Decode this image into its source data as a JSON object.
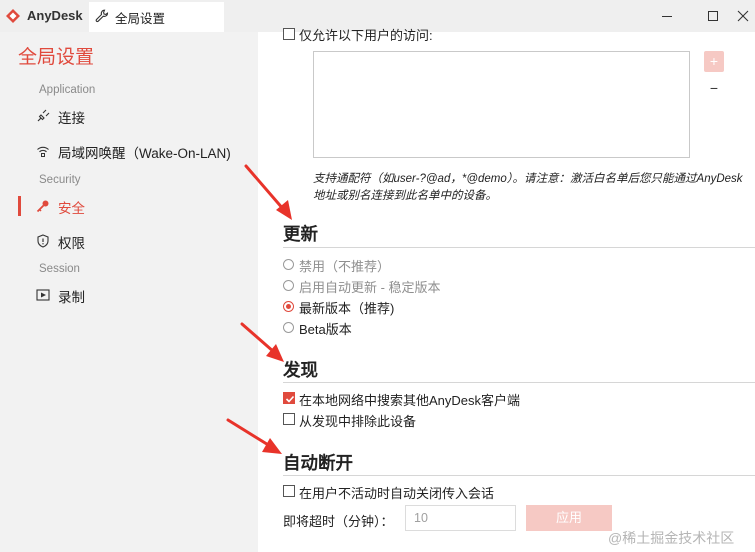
{
  "titlebar": {
    "app_name": "AnyDesk",
    "tab_label": "全局设置",
    "brand_color": "#e04a3d"
  },
  "sidebar": {
    "title": "全局设置",
    "sections": [
      {
        "label": "Application",
        "items": [
          {
            "label": "连接",
            "icon": "plug-icon"
          },
          {
            "label": "局域网唤醒（Wake-On-LAN)",
            "icon": "wifi-icon"
          }
        ]
      },
      {
        "label": "Security",
        "items": [
          {
            "label": "安全",
            "icon": "key-icon",
            "active": true
          },
          {
            "label": "权限",
            "icon": "shield-icon"
          }
        ]
      },
      {
        "label": "Session",
        "items": [
          {
            "label": "录制",
            "icon": "record-icon"
          }
        ]
      }
    ]
  },
  "access": {
    "label": "仅允许以下用户的访问:",
    "add_label": "+",
    "remove_label": "−",
    "hint_line1": "支持通配符（如user-?@ad，*@demo）。请注意：激活白名单后您只能通过AnyDesk",
    "hint_line2": "地址或别名连接到此名单中的设备。"
  },
  "update": {
    "heading": "更新",
    "options": [
      {
        "label": "禁用（不推荐）",
        "checked": false,
        "disabled": true
      },
      {
        "label": "启用自动更新 - 稳定版本",
        "checked": false,
        "disabled": true
      },
      {
        "label": "最新版本（推荐)",
        "checked": true,
        "disabled": false
      },
      {
        "label": "Beta版本",
        "checked": false,
        "disabled": false
      }
    ]
  },
  "discovery": {
    "heading": "发现",
    "options": [
      {
        "label": "在本地网络中搜索其他AnyDesk客户端",
        "checked": true
      },
      {
        "label": "从发现中排除此设备",
        "checked": false
      }
    ]
  },
  "autodisconnect": {
    "heading": "自动断开",
    "option_label": "在用户不活动时自动关闭传入会话",
    "option_checked": false,
    "timeout_label": "即将超时（分钟）：",
    "timeout_value": "10",
    "apply_label": "应用"
  },
  "watermark": "@稀土掘金技术社区"
}
